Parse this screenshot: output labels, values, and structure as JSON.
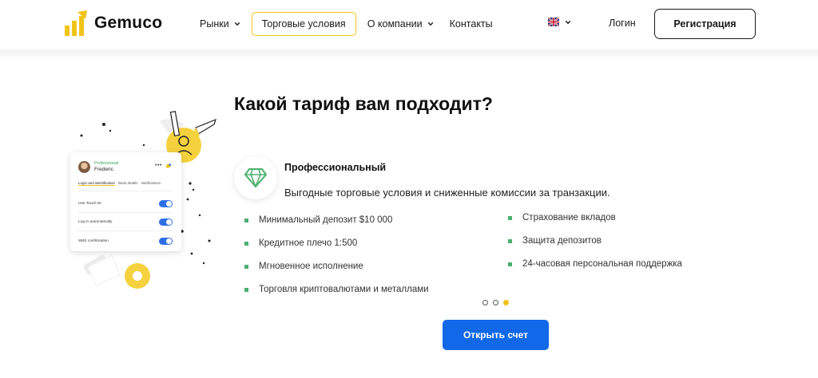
{
  "header": {
    "logo_text": "Gemuco",
    "nav": [
      {
        "label": "Рынки",
        "has_dropdown": true,
        "active": false
      },
      {
        "label": "Торговые условия",
        "has_dropdown": false,
        "active": true
      },
      {
        "label": "О компании",
        "has_dropdown": true,
        "active": false
      },
      {
        "label": "Контакты",
        "has_dropdown": false,
        "active": false
      }
    ],
    "language_icon": "uk-flag-icon",
    "login_label": "Логин",
    "register_label": "Регистрация"
  },
  "main": {
    "title": "Какой тариф вам подходит?",
    "illustration_card": {
      "role": "Professional",
      "name": "Frederic",
      "tabs": [
        "Login and identification",
        "Bank details",
        "Notifications"
      ],
      "settings": [
        "Use Touch ID",
        "Log in automatically",
        "SMS confirmation"
      ]
    },
    "plan": {
      "icon": "diamond-icon",
      "name": "Профессиональный",
      "description": "Выгодные торговые условия и сниженные комиссии за транзакции.",
      "features_left": [
        "Минимальный депозит $10 000",
        "Кредитное плечо 1:500",
        "Мгновенное исполнение",
        "Торговля криптовалютами и металлами"
      ],
      "features_right": [
        "Страхование вкладов",
        "Защита депозитов",
        "24-часовая персональная поддержка"
      ]
    },
    "carousel": {
      "count": 3,
      "active_index": 2
    },
    "open_account_label": "Открыть счет"
  },
  "colors": {
    "accent_yellow": "#f0c419",
    "primary_blue": "#1168e8",
    "bullet_green": "#4caf6d",
    "text_dark": "#111111"
  }
}
